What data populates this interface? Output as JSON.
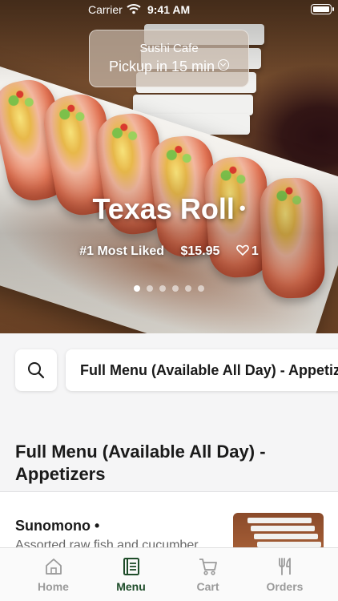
{
  "status_bar": {
    "carrier": "Carrier",
    "time": "9:41 AM"
  },
  "pickup": {
    "store_name": "Sushi Cafe",
    "eta": "Pickup in 15 min"
  },
  "featured": {
    "title": "Texas Roll",
    "title_marker": "•",
    "rank": "#1 Most Liked",
    "price": "$15.95",
    "likes": "1",
    "carousel": {
      "total": 6,
      "active_index": 0
    }
  },
  "search": {
    "icon": "search-icon"
  },
  "category_selector": {
    "value": "Full Menu (Available All Day) - Appetizers"
  },
  "section": {
    "title": "Full Menu (Available All Day) - Appetizers"
  },
  "menu_items": [
    {
      "name": "Sunomono",
      "marker": "•",
      "description": "Assorted raw fish and cucumber"
    }
  ],
  "tab_bar": {
    "active": "Menu",
    "tabs": [
      {
        "label": "Home",
        "icon": "home-icon"
      },
      {
        "label": "Menu",
        "icon": "menu-book-icon"
      },
      {
        "label": "Cart",
        "icon": "cart-icon"
      },
      {
        "label": "Orders",
        "icon": "fork-knife-icon"
      }
    ]
  },
  "colors": {
    "accent": "#1f4d2a",
    "inactive_tab": "#9a9a9a",
    "background": "#f5f5f6"
  }
}
